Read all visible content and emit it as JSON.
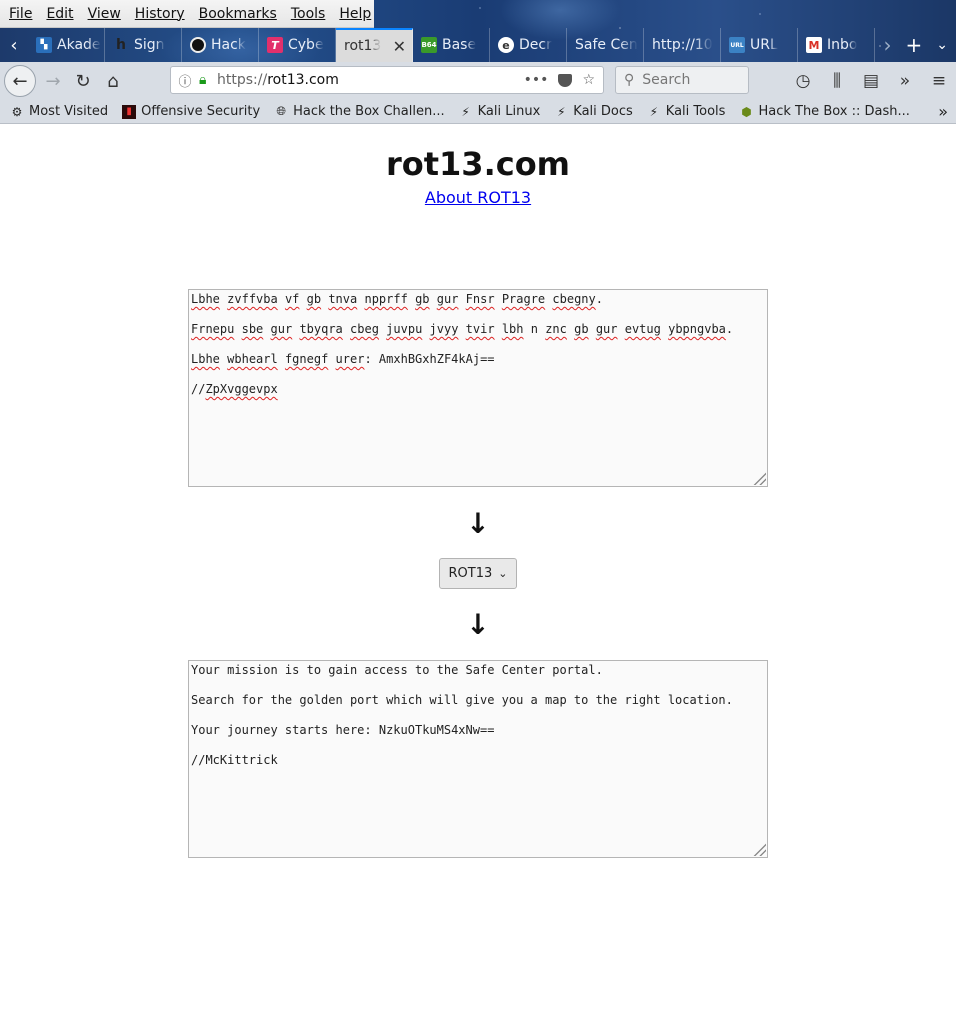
{
  "menubar": [
    "File",
    "Edit",
    "View",
    "History",
    "Bookmarks",
    "Tools",
    "Help"
  ],
  "tabs": [
    {
      "label": "Akade",
      "fav": "",
      "color": "#2a6fbb"
    },
    {
      "label": "Sign",
      "fav": "h",
      "color": "#444444"
    },
    {
      "label": "Hack",
      "fav": "",
      "color": "#111111"
    },
    {
      "label": "Cybe",
      "fav": "T",
      "color": "#e2306c"
    },
    {
      "label": "rot13",
      "fav": "",
      "color": "",
      "active": true
    },
    {
      "label": "Base",
      "fav": "B64",
      "color": "#3a9a2a"
    },
    {
      "label": "Decr",
      "fav": "",
      "color": "#ffffff"
    },
    {
      "label": "Safe Cen",
      "fav": "",
      "color": ""
    },
    {
      "label": "http://10",
      "fav": "",
      "color": ""
    },
    {
      "label": "URL",
      "fav": "URL",
      "color": "#3b82c4"
    },
    {
      "label": "Inbo",
      "fav": "M",
      "color": "#d93025"
    }
  ],
  "nav": {
    "url_prefix": "https://",
    "url_host": "rot13.com",
    "search_placeholder": "Search"
  },
  "bookmarks": [
    {
      "label": "Most Visited",
      "icon": "gear-icon"
    },
    {
      "label": "Offensive Security",
      "icon": "offsec-icon"
    },
    {
      "label": "Hack the Box Challen...",
      "icon": "globe-icon"
    },
    {
      "label": "Kali Linux",
      "icon": "kali-icon"
    },
    {
      "label": "Kali Docs",
      "icon": "kali-icon"
    },
    {
      "label": "Kali Tools",
      "icon": "kali-icon"
    },
    {
      "label": "Hack The Box :: Dash...",
      "icon": "htb-icon"
    }
  ],
  "page": {
    "title": "rot13.com",
    "about_link": "About ROT13",
    "input_lines": [
      "Lbhe zvffvba vf gb tnva npprff gb gur Fnsr Pragre cbegny.",
      "Frnepu sbe gur tbyqra cbeg juvpu jvyy tvir lbh n znc gb gur evtug ybpngvba.",
      "Lbhe wbhearl fgnegf urer: AmxhBGxhZF4kAj==",
      "//ZpXvggevpx"
    ],
    "cipher_selected": "ROT13",
    "output_lines": [
      "Your mission is to gain access to the Safe Center portal.",
      "Search for the golden port which will give you a map to the right location.",
      "Your journey starts here: NzkuOTkuMS4xNw==",
      "//McKittrick"
    ]
  }
}
